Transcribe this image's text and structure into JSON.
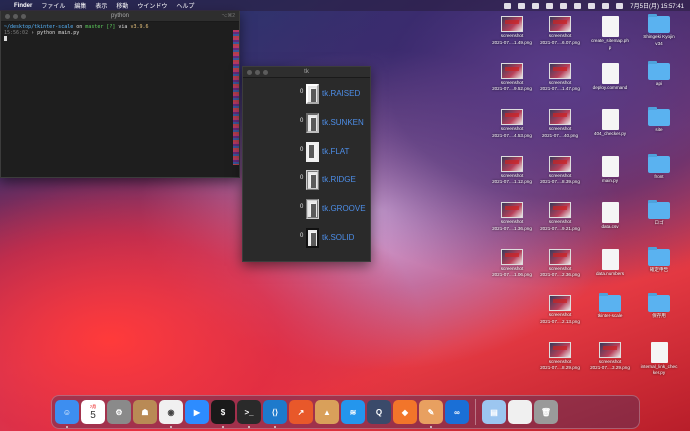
{
  "menubar": {
    "app_name": "Finder",
    "menus": [
      "ファイル",
      "編集",
      "表示",
      "移動",
      "ウインドウ",
      "ヘルプ"
    ],
    "clock": "7月5日(月) 15:57:41"
  },
  "terminal": {
    "title": "python",
    "shortcut": "⌥⌘2",
    "line1_path": "~/desktop/tkinter-scale",
    "line1_on": " on ",
    "line1_branch": "master [?]",
    "line1_via": " via ",
    "line1_py": "v3.9.6",
    "line2_time": "15:56:02",
    "line2_cmd": " › python main.py"
  },
  "tk_window": {
    "title": "tk",
    "rows": [
      {
        "value": "0",
        "label": "tk.RAISED"
      },
      {
        "value": "0",
        "label": "tk.SUNKEN"
      },
      {
        "value": "0",
        "label": "tk.FLAT"
      },
      {
        "value": "0",
        "label": "tk.RIDGE"
      },
      {
        "value": "0",
        "label": "tk.GROOVE"
      },
      {
        "value": "0",
        "label": "tk.SOLID"
      }
    ]
  },
  "desktop": {
    "icons": [
      {
        "label1": "screenshot",
        "label2": "2021-07....1.49.png",
        "type": "image"
      },
      {
        "label1": "screenshot",
        "label2": "2021-07....6.07.png",
        "type": "image"
      },
      {
        "label1": "create_sitemap.ph",
        "label2": "p",
        "type": "php"
      },
      {
        "label1": "Shingeki Kyojin",
        "label2": "v34",
        "type": "folder"
      },
      {
        "label1": "screenshot",
        "label2": "2021-07....9.52.png",
        "type": "image"
      },
      {
        "label1": "screenshot",
        "label2": "2021-07....1.47.png",
        "type": "image"
      },
      {
        "label1": "deploy.command",
        "label2": "",
        "type": "shell"
      },
      {
        "label1": "api",
        "label2": "",
        "type": "folder"
      },
      {
        "label1": "screenshot",
        "label2": "2021-07....4.53.png",
        "type": "image"
      },
      {
        "label1": "screenshot",
        "label2": "2021-07....40.png",
        "type": "image"
      },
      {
        "label1": "404_checker.py",
        "label2": "",
        "type": "py"
      },
      {
        "label1": "site",
        "label2": "",
        "type": "folder"
      },
      {
        "label1": "screenshot",
        "label2": "2021-07....1.12.png",
        "type": "image"
      },
      {
        "label1": "screenshot",
        "label2": "2021-07....8.39.png",
        "type": "image"
      },
      {
        "label1": "main.py",
        "label2": "",
        "type": "py"
      },
      {
        "label1": "front",
        "label2": "",
        "type": "folder"
      },
      {
        "label1": "screenshot",
        "label2": "2021-07....1.36.png",
        "type": "image"
      },
      {
        "label1": "screenshot",
        "label2": "2021-07....9.21.png",
        "type": "image"
      },
      {
        "label1": "data.csv",
        "label2": "",
        "type": "csv"
      },
      {
        "label1": "ロゴ",
        "label2": "",
        "type": "folder"
      },
      {
        "label1": "screenshot",
        "label2": "2021-07....1.06.png",
        "type": "image"
      },
      {
        "label1": "screenshot",
        "label2": "2021-07....2.36.png",
        "type": "image"
      },
      {
        "label1": "data.numbers",
        "label2": "",
        "type": "numbers"
      },
      {
        "label1": "確定申告",
        "label2": "",
        "type": "folder"
      },
      {
        "label1": "screenshot",
        "label2": "2021-07....2.13.png",
        "type": "image"
      },
      {
        "label1": "tkinter-scale",
        "label2": "",
        "type": "folder"
      },
      {
        "label1": "保存用",
        "label2": "",
        "type": "folder"
      },
      {
        "label1": "screenshot",
        "label2": "2021-07....8.29.png",
        "type": "image"
      },
      {
        "label1": "screenshot",
        "label2": "2021-07....3.29.png",
        "type": "image"
      },
      {
        "label1": "internal_link_chec",
        "label2": "ker.py",
        "type": "py"
      }
    ]
  },
  "dock": {
    "calendar_month": "7月",
    "calendar_day": "5",
    "apps": [
      {
        "name": "finder-icon",
        "color": "#3d8ef0",
        "glyph": "☺"
      },
      {
        "name": "calendar-icon",
        "color": "#ffffff",
        "glyph": ""
      },
      {
        "name": "system-preferences-icon",
        "color": "#8a8a8a",
        "glyph": "⚙"
      },
      {
        "name": "contacts-icon",
        "color": "#b98a55",
        "glyph": "☗"
      },
      {
        "name": "chrome-icon",
        "color": "#f0f0f0",
        "glyph": "◉"
      },
      {
        "name": "zoom-icon",
        "color": "#2d8cff",
        "glyph": "▶"
      },
      {
        "name": "iterm-icon",
        "color": "#1a1a1a",
        "glyph": "$"
      },
      {
        "name": "terminal-icon",
        "color": "#2a2a2a",
        "glyph": ">_"
      },
      {
        "name": "vscode-icon",
        "color": "#1e7acc",
        "glyph": "⟨⟩"
      },
      {
        "name": "activity-icon",
        "color": "#e8582a",
        "glyph": "↗"
      },
      {
        "name": "transmit-icon",
        "color": "#d9a05a",
        "glyph": "▲"
      },
      {
        "name": "docker-icon",
        "color": "#2496ed",
        "glyph": "≋"
      },
      {
        "name": "quicktime-icon",
        "color": "#3a4a6a",
        "glyph": "Q"
      },
      {
        "name": "sourcetree-icon",
        "color": "#f2752a",
        "glyph": "◆"
      },
      {
        "name": "pages-icon",
        "color": "#e8a060",
        "glyph": "✎"
      },
      {
        "name": "remote-desktop-icon",
        "color": "#1a6fd6",
        "glyph": "∞"
      },
      {
        "name": "preview-icon",
        "color": "#9cc6f0",
        "glyph": "▤"
      },
      {
        "name": "document-icon",
        "color": "#f0f0f0",
        "glyph": ""
      },
      {
        "name": "trash-icon",
        "color": "#9a9a9a",
        "glyph": "🗑"
      }
    ]
  }
}
